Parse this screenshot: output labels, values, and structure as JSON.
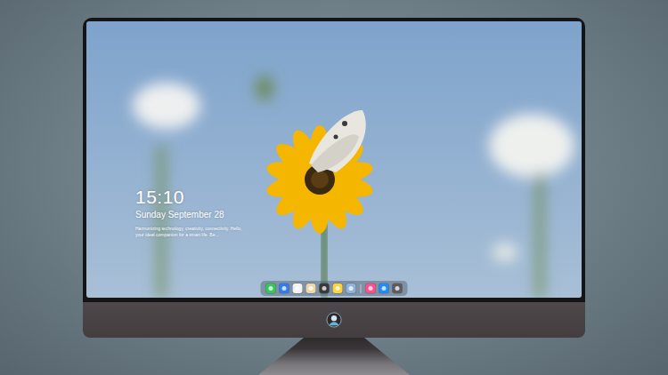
{
  "clock": {
    "time": "15:10",
    "date": "Sunday September 28",
    "tagline": "Harmonizing technology, creativity, connectivity. Hello, your ideal companion for a smart life. Be..."
  },
  "dock": {
    "groups": [
      [
        {
          "color": "#34c759"
        },
        {
          "color": "#2f7cf6"
        },
        {
          "color": "#f2f2f2"
        },
        {
          "color": "#e9d9a8"
        },
        {
          "color": "#3a3a3c"
        },
        {
          "color": "#ffd23f"
        },
        {
          "color": "#8fb4d9"
        }
      ],
      [
        {
          "color": "#ff4f8b"
        },
        {
          "color": "#1e8bff"
        },
        {
          "color": "#5b5b60"
        }
      ]
    ]
  }
}
